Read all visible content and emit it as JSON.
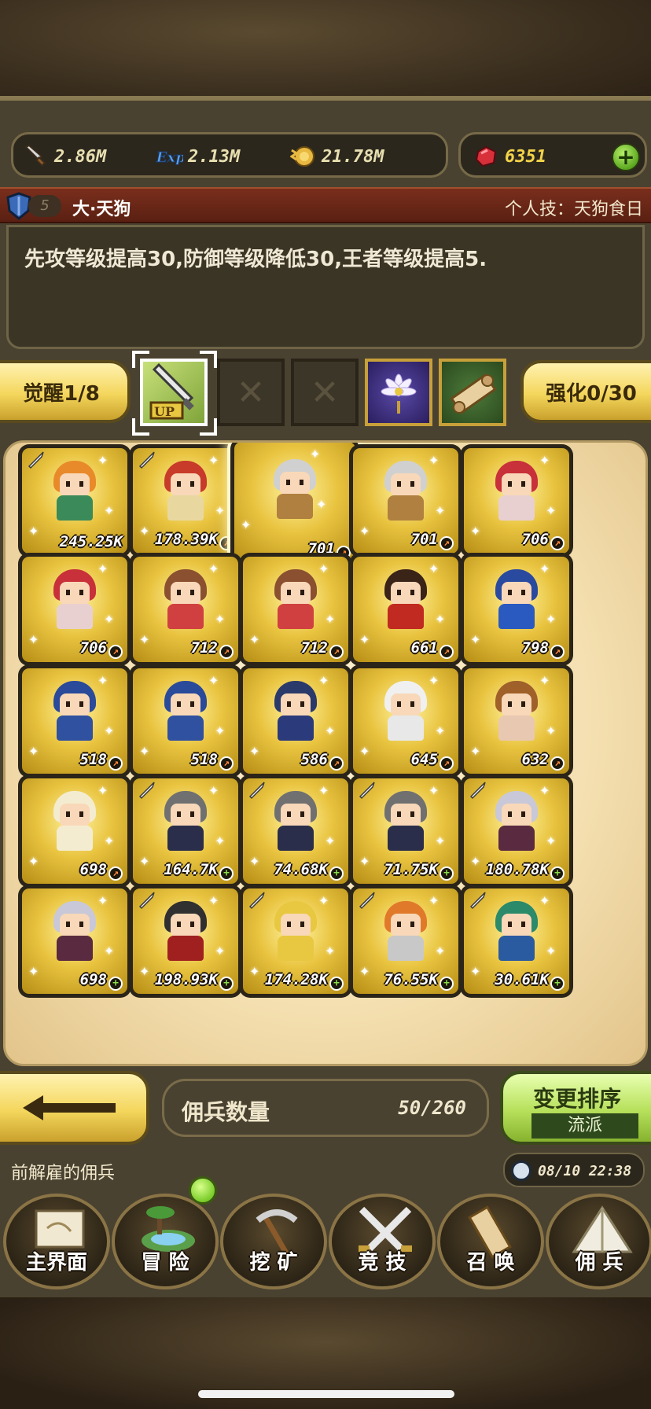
{
  "resources": {
    "attack": "2.86M",
    "exp": "2.13M",
    "gold": "21.78M",
    "gems": "6351",
    "add_label": "+"
  },
  "mercenary": {
    "level_badge": "5",
    "name": "大·天狗",
    "skill": "个人技：天狗食日",
    "description": "先攻等级提高30,防御等级降低30,王者等级提高5."
  },
  "awaken": {
    "awaken_label": "觉醒1/8",
    "enhance_label": "强化0/30",
    "up_label": "UP",
    "empty_slot": "✕"
  },
  "cards": [
    {
      "value": "245.25K",
      "mark": "",
      "hair": "#e88a2a",
      "body": "#3a8a5a",
      "tag": "sword"
    },
    {
      "value": "178.39K",
      "mark": "up",
      "hair": "#c83a2a",
      "body": "#e8d8a0",
      "tag": "sword"
    },
    {
      "value": "701",
      "mark": "up",
      "hair": "#d0d0d0",
      "body": "#b08040",
      "tag": ""
    },
    {
      "value": "701",
      "mark": "up",
      "hair": "#d0d0d0",
      "body": "#b08040",
      "tag": ""
    },
    {
      "value": "706",
      "mark": "up",
      "hair": "#c8303a",
      "body": "#e8d0d0",
      "tag": ""
    },
    {
      "value": "706",
      "mark": "up",
      "hair": "#c8303a",
      "body": "#e8d0d0",
      "tag": ""
    },
    {
      "value": "712",
      "mark": "up",
      "hair": "#8a5030",
      "body": "#d04040",
      "tag": ""
    },
    {
      "value": "712",
      "mark": "up",
      "hair": "#8a5030",
      "body": "#d04040",
      "tag": ""
    },
    {
      "value": "661",
      "mark": "up",
      "hair": "#3a2418",
      "body": "#c02a20",
      "tag": ""
    },
    {
      "value": "798",
      "mark": "up",
      "hair": "#2a4aa0",
      "body": "#2a5ac0",
      "tag": ""
    },
    {
      "value": "518",
      "mark": "up",
      "hair": "#2a4a9a",
      "body": "#3050a0",
      "tag": ""
    },
    {
      "value": "518",
      "mark": "up",
      "hair": "#2a4a9a",
      "body": "#3050a0",
      "tag": ""
    },
    {
      "value": "586",
      "mark": "up",
      "hair": "#2a3a6a",
      "body": "#2a3a7a",
      "tag": ""
    },
    {
      "value": "645",
      "mark": "up",
      "hair": "#f0f0f0",
      "body": "#e8e8e8",
      "tag": ""
    },
    {
      "value": "632",
      "mark": "up",
      "hair": "#a0602a",
      "body": "#e8c8b0",
      "tag": ""
    },
    {
      "value": "698",
      "mark": "up",
      "hair": "#f4ecd0",
      "body": "#f4ecd0",
      "tag": ""
    },
    {
      "value": "164.7K",
      "mark": "plus",
      "hair": "#707070",
      "body": "#2a2e4a",
      "tag": "sword"
    },
    {
      "value": "74.68K",
      "mark": "plus",
      "hair": "#707070",
      "body": "#2a2e4a",
      "tag": "sword"
    },
    {
      "value": "71.75K",
      "mark": "plus",
      "hair": "#707070",
      "body": "#2a2e4a",
      "tag": "sword"
    },
    {
      "value": "180.78K",
      "mark": "plus",
      "hair": "#c8c8d8",
      "body": "#5a2a40",
      "tag": "sword"
    },
    {
      "value": "698",
      "mark": "plus",
      "hair": "#c8c8d8",
      "body": "#5a2a40",
      "tag": ""
    },
    {
      "value": "198.93K",
      "mark": "plus",
      "hair": "#303030",
      "body": "#a02020",
      "tag": "sword"
    },
    {
      "value": "174.28K",
      "mark": "plus",
      "hair": "#e8c840",
      "body": "#e8c840",
      "tag": "sword"
    },
    {
      "value": "76.55K",
      "mark": "plus",
      "hair": "#e07a2a",
      "body": "#c8c8c8",
      "tag": "sword"
    },
    {
      "value": "30.61K",
      "mark": "plus",
      "hair": "#2a8a6a",
      "body": "#2a5aa0",
      "tag": "sword"
    }
  ],
  "footer": {
    "count_label": "佣兵数量",
    "count_value": "50/260",
    "sort_label": "变更排序",
    "sort_mode": "流派",
    "notice": "前解雇的佣兵",
    "time": "08/10 22:38"
  },
  "nav": {
    "home": "主界面",
    "adventure": "冒 险",
    "mine": "挖 矿",
    "arena": "竞 技",
    "summon": "召 唤",
    "mercenary": "佣 兵"
  },
  "colors": {
    "gold_button": "#f4d65c",
    "green_button": "#b6e05a",
    "title_bar": "#7a2e1c"
  }
}
